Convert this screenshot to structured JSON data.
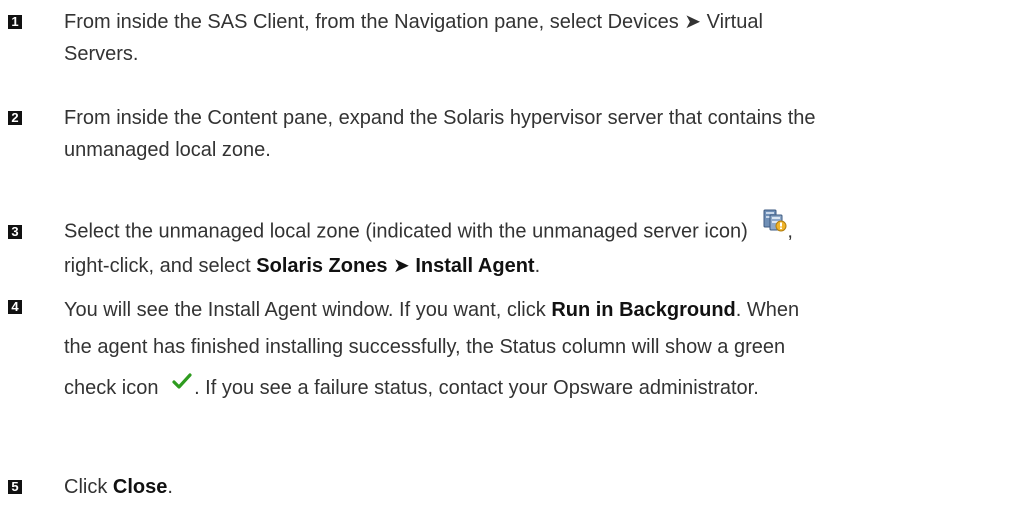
{
  "steps": [
    {
      "number": "1",
      "line1": "From inside the SAS Client, from the Navigation pane, select Devices ➤ Virtual",
      "line2": "Servers."
    },
    {
      "number": "2",
      "line1": "From inside the Content pane, expand the Solaris hypervisor server that contains the",
      "line2": "unmanaged local zone."
    },
    {
      "number": "3",
      "line1": "Select the unmanaged local zone (indicated with the unmanaged server icon)",
      "line1_end": ",",
      "line2_pre": "right-click, and select ",
      "line2_bold": "Solaris Zones ➤ Install Agent",
      "line2_post": "."
    },
    {
      "number": "4",
      "line1_pre": "You will see the Install Agent window. If you want, click ",
      "line1_bold": "Run in Background",
      "line1_post": ". When",
      "line2": "the agent has finished installing successfully, the Status column will show a green",
      "line3_pre": "check icon",
      "line3_post": ". If you see a failure status, contact your Opsware administrator."
    },
    {
      "number": "5",
      "line1_pre": "Click ",
      "line1_bold": "Close",
      "line1_post": "."
    }
  ],
  "icons": {
    "unmanaged_server": "unmanaged-server-icon",
    "green_check": "green-check-icon"
  },
  "colors": {
    "text": "#333333",
    "badge": "#111111",
    "check": "#2e9b1f"
  }
}
